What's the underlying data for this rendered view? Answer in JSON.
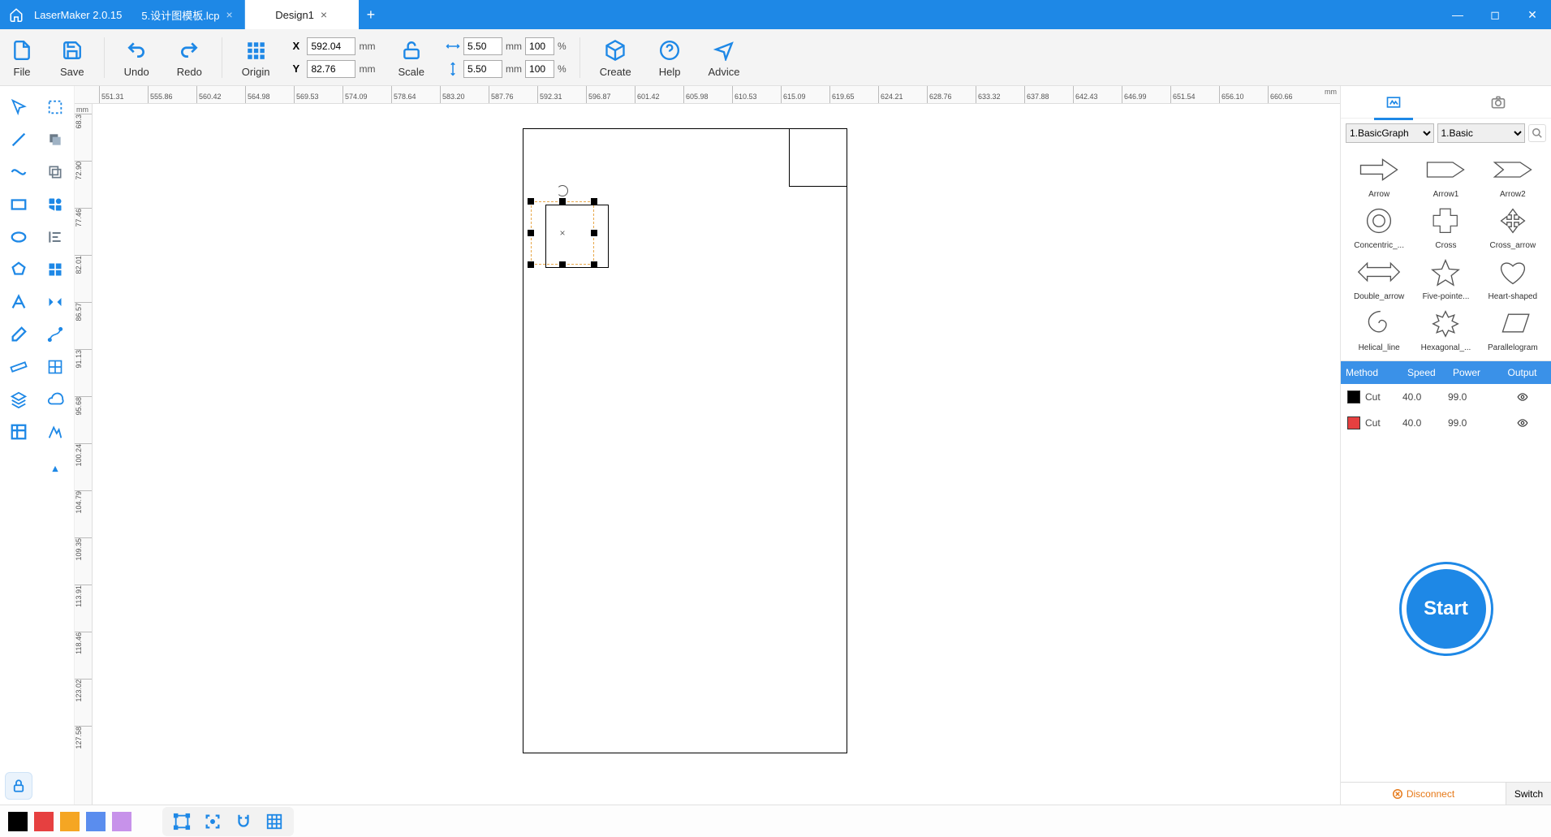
{
  "app": {
    "title": "LaserMaker 2.0.15"
  },
  "tabs": [
    {
      "label": "5.设计图模板.lcp",
      "active": false
    },
    {
      "label": "Design1",
      "active": true
    }
  ],
  "toolbar": {
    "file": "File",
    "save": "Save",
    "undo": "Undo",
    "redo": "Redo",
    "origin": "Origin",
    "scale": "Scale",
    "create": "Create",
    "help": "Help",
    "advice": "Advice",
    "x_value": "592.04",
    "y_value": "82.76",
    "unit_mm": "mm",
    "w_value": "5.50",
    "h_value": "5.50",
    "pct_w": "100",
    "pct_h": "100",
    "pct": "%"
  },
  "ruler": {
    "unit": "mm",
    "h_ticks": [
      "551.31",
      "555.86",
      "560.42",
      "564.98",
      "569.53",
      "574.09",
      "578.64",
      "583.20",
      "587.76",
      "592.31",
      "596.87",
      "601.42",
      "605.98",
      "610.53",
      "615.09",
      "619.65",
      "624.21",
      "628.76",
      "633.32",
      "637.88",
      "642.43",
      "646.99",
      "651.54",
      "656.10",
      "660.66"
    ],
    "v_ticks": [
      "68.3",
      "72.90",
      "77.46",
      "82.01",
      "86.57",
      "91.13",
      "95.68",
      "100.24",
      "104.79",
      "109.35",
      "113.91",
      "118.46",
      "123.02",
      "127.58"
    ]
  },
  "shapes_panel": {
    "cat1": "1.BasicGraph",
    "cat2": "1.Basic",
    "items": [
      "Arrow",
      "Arrow1",
      "Arrow2",
      "Concentric_...",
      "Cross",
      "Cross_arrow",
      "Double_arrow",
      "Five-pointe...",
      "Heart-shaped",
      "Helical_line",
      "Hexagonal_...",
      "Parallelogram"
    ]
  },
  "layers": {
    "headers": {
      "method": "Method",
      "speed": "Speed",
      "power": "Power",
      "output": "Output"
    },
    "rows": [
      {
        "color": "#000000",
        "method": "Cut",
        "speed": "40.0",
        "power": "99.0"
      },
      {
        "color": "#e64040",
        "method": "Cut",
        "speed": "40.0",
        "power": "99.0"
      }
    ]
  },
  "start_label": "Start",
  "disconnect_label": "Disconnect",
  "switch_label": "Switch",
  "bottom_colors": [
    "#000000",
    "#e64040",
    "#f5a623",
    "#5a8dee",
    "#c792ea"
  ]
}
